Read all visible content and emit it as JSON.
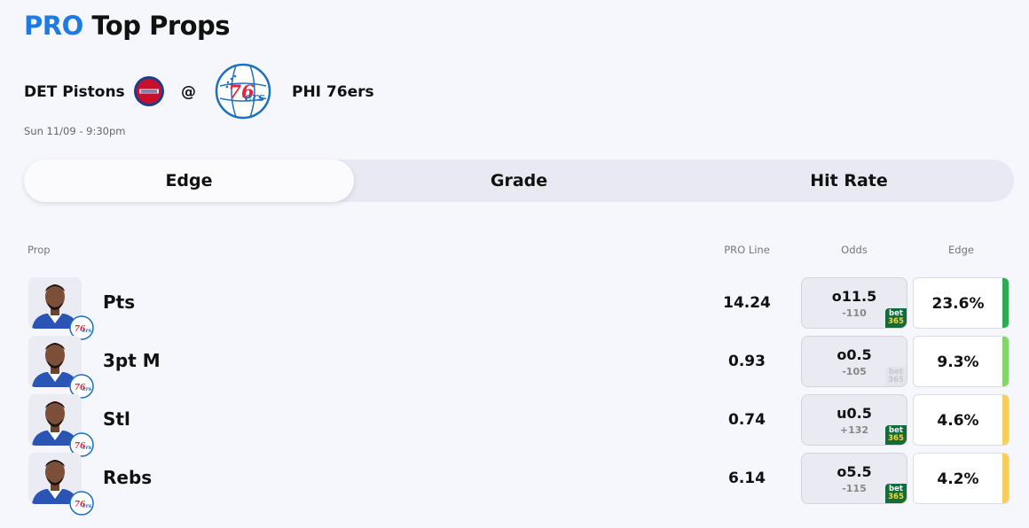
{
  "header": {
    "title_pro": "PRO",
    "title_rest": "Top Props"
  },
  "matchup": {
    "away_team": "DET Pistons",
    "separator": "@",
    "home_team": "PHI 76ers",
    "datetime": "Sun 11/09 - 9:30pm"
  },
  "tabs": [
    {
      "label": "Edge",
      "active": true
    },
    {
      "label": "Grade",
      "active": false
    },
    {
      "label": "Hit Rate",
      "active": false
    }
  ],
  "columns": {
    "prop": "Prop",
    "pro_line": "PRO Line",
    "odds": "Odds",
    "edge": "Edge"
  },
  "rows": [
    {
      "prop": "Pts",
      "pro_line": "14.24",
      "odds_line": "o11.5",
      "odds_price": "-110",
      "book": "bet365",
      "book_active": true,
      "edge": "23.6%",
      "edge_color": "#2eaa55"
    },
    {
      "prop": "3pt M",
      "pro_line": "0.93",
      "odds_line": "o0.5",
      "odds_price": "-105",
      "book": "bet365",
      "book_active": false,
      "edge": "9.3%",
      "edge_color": "#86d46a"
    },
    {
      "prop": "Stl",
      "pro_line": "0.74",
      "odds_line": "u0.5",
      "odds_price": "+132",
      "book": "bet365",
      "book_active": true,
      "edge": "4.6%",
      "edge_color": "#f5cf5a"
    },
    {
      "prop": "Rebs",
      "pro_line": "6.14",
      "odds_line": "o5.5",
      "odds_price": "-115",
      "book": "bet365",
      "book_active": true,
      "edge": "4.2%",
      "edge_color": "#f5cf5a"
    }
  ],
  "colors": {
    "brand_blue": "#1e7be6",
    "sixers_blue": "#1d6fc1",
    "sixers_red": "#e0263a",
    "pistons_red": "#c8102e",
    "pistons_navy": "#1d3e87"
  },
  "icons": {
    "away_logo": "pistons-logo",
    "home_logo": "sixers-logo",
    "player_avatar": "player-avatar",
    "team_badge": "sixers-badge-icon",
    "book": "bet365-icon"
  }
}
